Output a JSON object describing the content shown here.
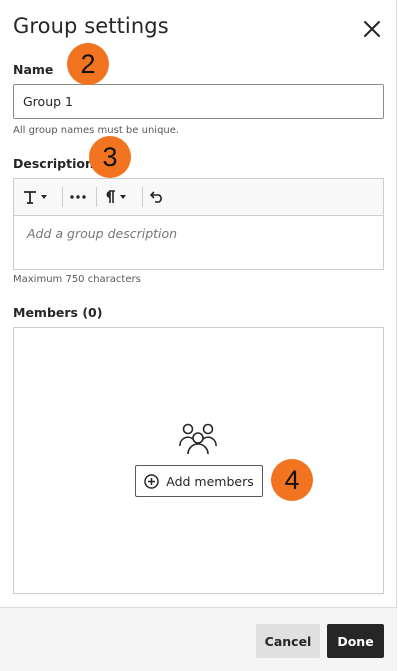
{
  "panel": {
    "title": "Group settings",
    "close_icon": "close-icon"
  },
  "name_section": {
    "label": "Name",
    "value": "Group 1",
    "hint": "All group names must be unique."
  },
  "description_section": {
    "label": "Description",
    "toolbar": {
      "text_style_icon": "text-format-icon",
      "more_icon": "more-options-icon",
      "paragraph_icon": "paragraph-icon",
      "undo_icon": "undo-icon"
    },
    "placeholder": "Add a group description",
    "hint": "Maximum 750 characters"
  },
  "members_section": {
    "label": "Members (0)",
    "empty_icon": "group-icon",
    "add_button_label": "Add members",
    "add_icon": "plus-circle-icon"
  },
  "callouts": {
    "badge_2": "2",
    "badge_3": "3",
    "badge_4": "4",
    "color": "#f27420"
  },
  "footer": {
    "cancel_label": "Cancel",
    "done_label": "Done"
  }
}
